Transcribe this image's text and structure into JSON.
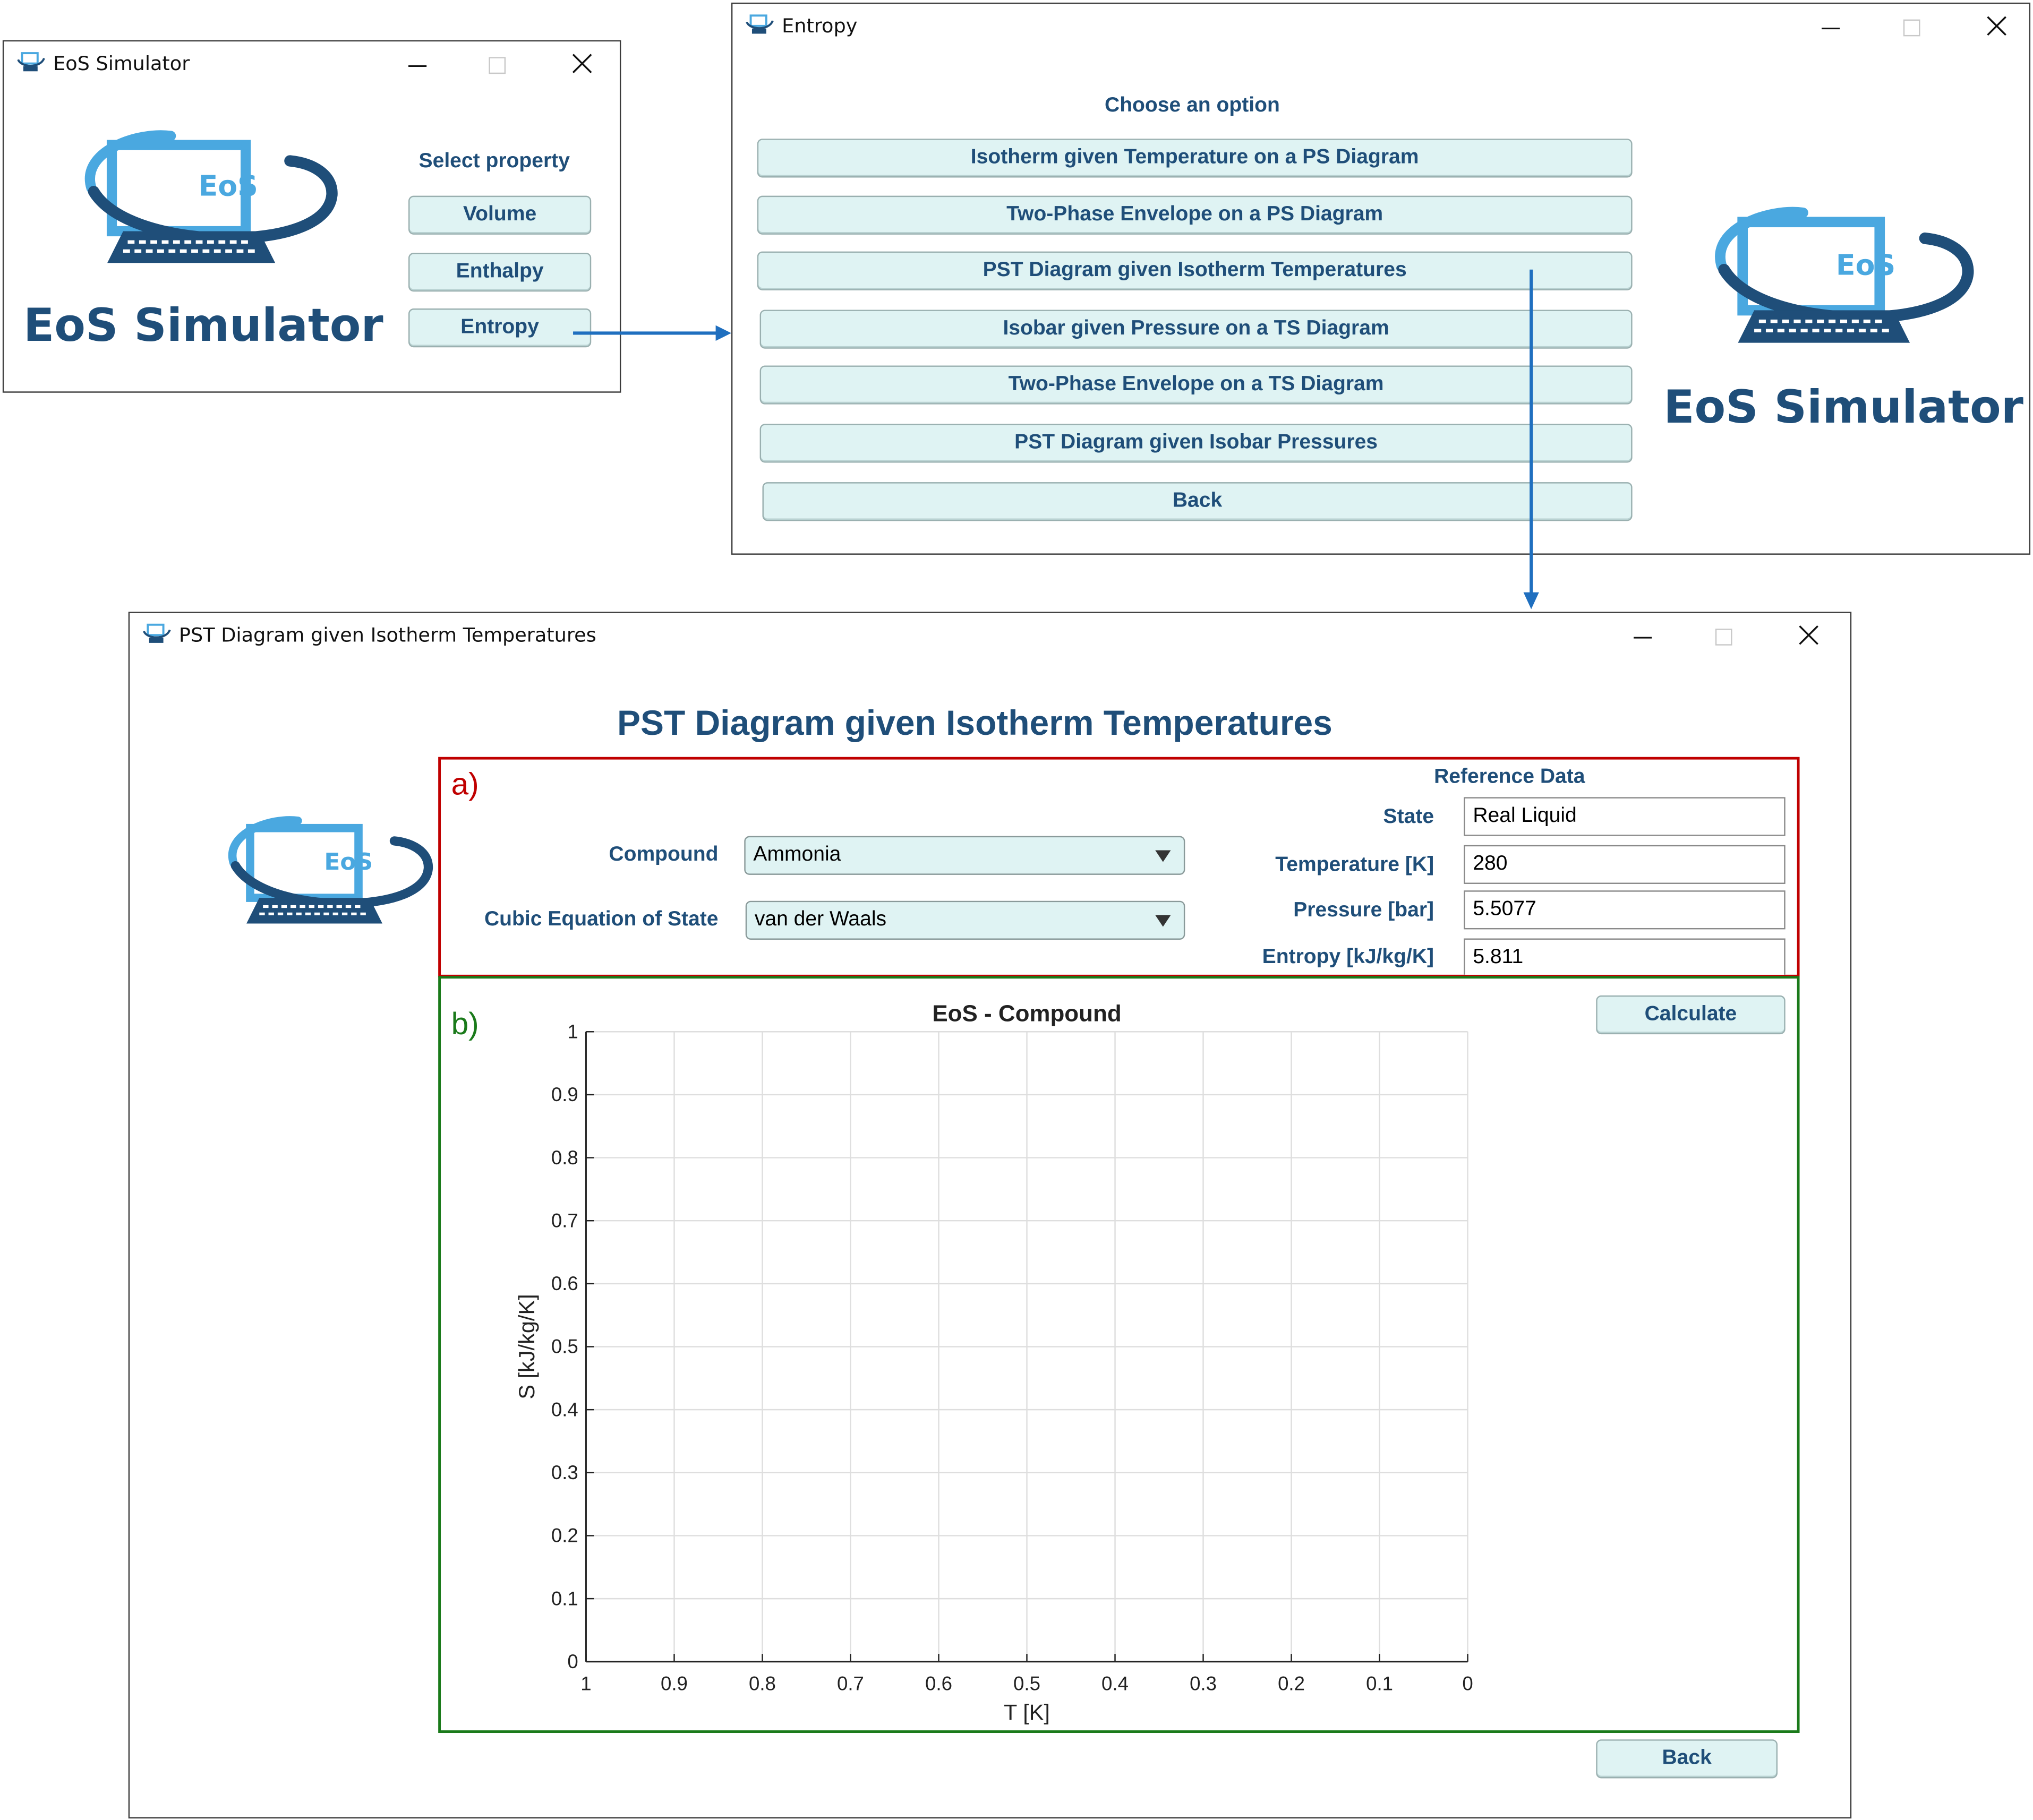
{
  "win1": {
    "title": "EoS Simulator",
    "logo_badge": "EoS",
    "logo_text": "EoS Simulator",
    "heading": "Select property",
    "buttons": [
      "Volume",
      "Enthalpy",
      "Entropy"
    ]
  },
  "win2": {
    "title": "Entropy",
    "heading": "Choose an option",
    "options": [
      "Isotherm given Temperature on a PS Diagram",
      "Two-Phase Envelope on a PS Diagram",
      "PST Diagram given Isotherm Temperatures",
      "Isobar given Pressure on a TS Diagram",
      "Two-Phase Envelope on a TS Diagram",
      "PST Diagram given Isobar Pressures",
      "Back"
    ],
    "logo_badge": "EoS",
    "logo_text": "EoS Simulator"
  },
  "win3": {
    "title": "PST Diagram given Isotherm Temperatures",
    "heading": "PST Diagram given Isotherm Temperatures",
    "logo_badge": "EoS",
    "section_a_label": "a)",
    "section_b_label": "b)",
    "compound_label": "Compound",
    "compound_value": "Ammonia",
    "eos_label": "Cubic Equation of State",
    "eos_value": "van der Waals",
    "reference_heading": "Reference Data",
    "reference": [
      {
        "label": "State",
        "value": "Real Liquid"
      },
      {
        "label": "Temperature [K]",
        "value": "280"
      },
      {
        "label": "Pressure [bar]",
        "value": "5.5077"
      },
      {
        "label": "Entropy [kJ/kg/K]",
        "value": "5.811"
      }
    ],
    "calculate_label": "Calculate",
    "back_label": "Back"
  },
  "colors": {
    "label_blue": "#1f4e79",
    "button_fill": "#dff3f3",
    "arrow_blue": "#1f6fbf",
    "box_a_red": "#c00000",
    "box_b_green": "#1a7a1a",
    "logo_light": "#4aa8e0",
    "logo_dark": "#1f4e79"
  },
  "chart_data": {
    "type": "line",
    "title": "EoS - Compound",
    "xlabel": "T [K]",
    "ylabel": "S [kJ/kg/K]",
    "xlim": [
      1,
      0
    ],
    "ylim": [
      0,
      1
    ],
    "x_reversed": true,
    "x_ticks": [
      "1",
      "0.9",
      "0.8",
      "0.7",
      "0.6",
      "0.5",
      "0.4",
      "0.3",
      "0.2",
      "0.1",
      "0"
    ],
    "y_ticks": [
      "0",
      "0.1",
      "0.2",
      "0.3",
      "0.4",
      "0.5",
      "0.6",
      "0.7",
      "0.8",
      "0.9",
      "1"
    ],
    "grid": true,
    "series": []
  }
}
